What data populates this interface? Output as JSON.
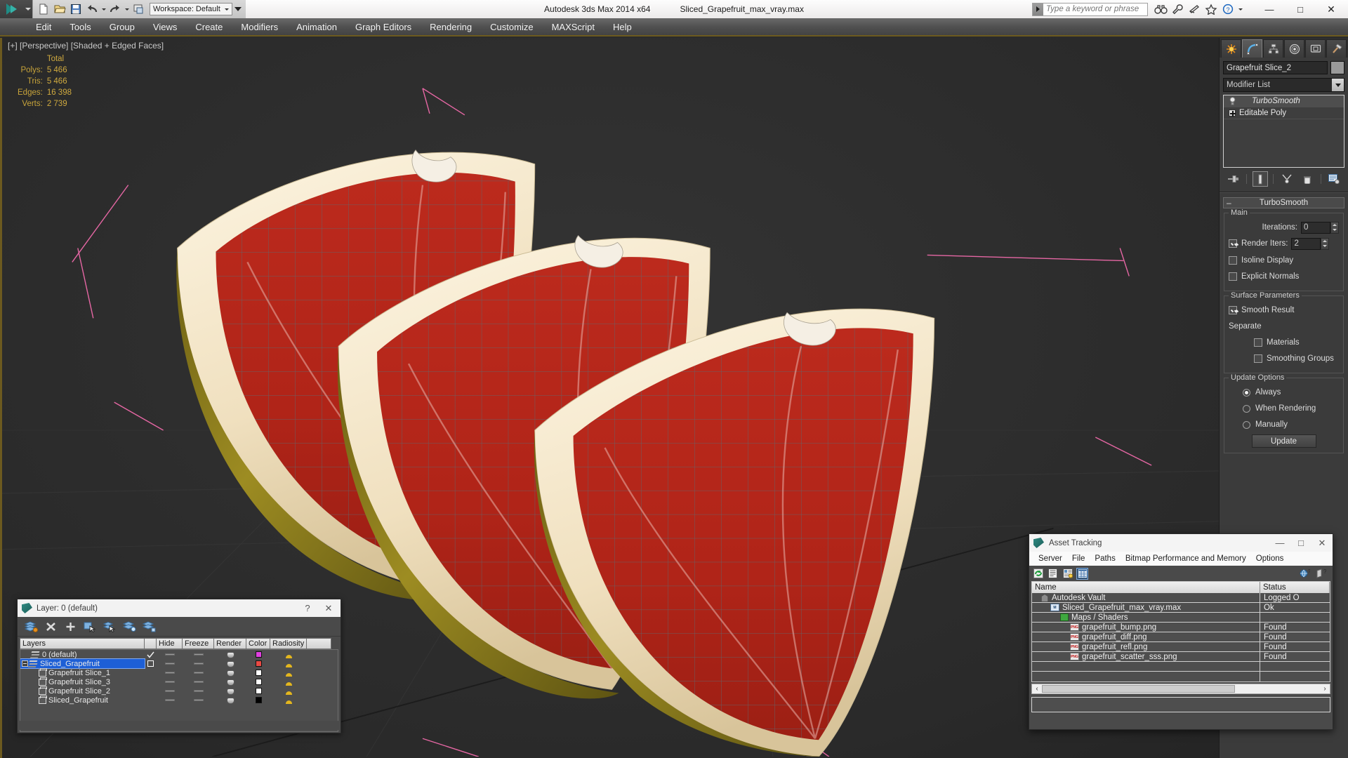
{
  "titlebar": {
    "app_title": "Autodesk 3ds Max  2014 x64",
    "file_title": "Sliced_Grapefruit_max_vray.max",
    "workspace_label": "Workspace: Default",
    "quick_access": [
      {
        "name": "new-file-icon",
        "label": "New"
      },
      {
        "name": "open-file-icon",
        "label": "Open"
      },
      {
        "name": "save-file-icon",
        "label": "Save"
      },
      {
        "name": "undo-icon",
        "label": "Undo"
      },
      {
        "name": "redo-icon",
        "label": "Redo"
      },
      {
        "name": "project-folder-icon",
        "label": "Set Project Folder"
      }
    ],
    "search_placeholder": "Type a keyword or phrase",
    "right_icons": [
      "binoculars-icon",
      "wrench-icon",
      "satellite-icon",
      "star-icon",
      "help-icon"
    ],
    "window_buttons": {
      "minimize": "—",
      "maximize": "□",
      "close": "✕"
    }
  },
  "menubar": {
    "items": [
      "Edit",
      "Tools",
      "Group",
      "Views",
      "Create",
      "Modifiers",
      "Animation",
      "Graph Editors",
      "Rendering",
      "Customize",
      "MAXScript",
      "Help"
    ]
  },
  "viewport": {
    "label": "[+] [Perspective] [Shaded + Edged Faces]",
    "stats": {
      "header": "Total",
      "rows": [
        {
          "label": "Polys:",
          "value": "5 466"
        },
        {
          "label": "Tris:",
          "value": "5 466"
        },
        {
          "label": "Edges:",
          "value": "16 398"
        },
        {
          "label": "Verts:",
          "value": "2 739"
        }
      ]
    },
    "colors": {
      "background": "#2e2e2e",
      "flesh_red": "#b5261b",
      "pith_cream": "#f2e3c8",
      "peel_olive": "#8a7a1c",
      "selection_bracket": "#e667a4",
      "wireframe": "#6e7b80"
    }
  },
  "command_panel": {
    "tabs": [
      {
        "name": "create-tab",
        "icon": "star-burst-icon",
        "active": false
      },
      {
        "name": "modify-tab",
        "icon": "curve-arc-icon",
        "active": true
      },
      {
        "name": "hierarchy-tab",
        "icon": "hierarchy-icon",
        "active": false
      },
      {
        "name": "motion-tab",
        "icon": "motion-wheel-icon",
        "active": false
      },
      {
        "name": "display-tab",
        "icon": "display-monitor-icon",
        "active": false
      },
      {
        "name": "utilities-tab",
        "icon": "hammer-icon",
        "active": false
      }
    ],
    "object_name": "Grapefruit Slice_2",
    "modifier_list_label": "Modifier List",
    "stack": [
      {
        "label": "TurboSmooth",
        "selected": true,
        "icon": "lightbulb-icon"
      },
      {
        "label": "Editable Poly",
        "selected": false,
        "icon": "plus-box-icon"
      }
    ],
    "stack_buttons": [
      "pin-stack-icon",
      "show-end-result-icon",
      "make-unique-icon",
      "remove-modifier-icon",
      "configure-sets-icon"
    ],
    "rollout": {
      "title": "TurboSmooth",
      "collapse_glyph": "–",
      "main": {
        "title": "Main",
        "iterations_label": "Iterations:",
        "iterations_value": "0",
        "render_iters_label": "Render Iters:",
        "render_iters_value": "2",
        "render_iters_checked": true,
        "isoline_display_label": "Isoline Display",
        "isoline_display_checked": false,
        "explicit_normals_label": "Explicit Normals",
        "explicit_normals_checked": false
      },
      "surface_parameters": {
        "title": "Surface Parameters",
        "smooth_result_label": "Smooth Result",
        "smooth_result_checked": true,
        "separate_label": "Separate",
        "materials_label": "Materials",
        "materials_checked": false,
        "smoothing_groups_label": "Smoothing Groups",
        "smoothing_groups_checked": false
      },
      "update_options": {
        "title": "Update Options",
        "options": [
          {
            "label": "Always",
            "selected": true
          },
          {
            "label": "When Rendering",
            "selected": false
          },
          {
            "label": "Manually",
            "selected": false
          }
        ],
        "update_button": "Update"
      }
    }
  },
  "layer_dialog": {
    "title": "Layer: 0 (default)",
    "help_glyph": "?",
    "close_glyph": "✕",
    "toolbar_icons": [
      "create-new-layer-icon",
      "delete-layer-icon",
      "add-layer-icon",
      "select-objects-icon",
      "select-highlight-icon",
      "hide-layer-icon",
      "layer-properties-icon"
    ],
    "columns": [
      "Layers",
      "",
      "Hide",
      "Freeze",
      "Render",
      "Color",
      "Radiosity",
      ""
    ],
    "rows": [
      {
        "name": "0 (default)",
        "indent": 1,
        "icon": "layers-icon",
        "hide_check": true,
        "color": "#e040e0",
        "selected": false,
        "expander": false
      },
      {
        "name": "Sliced_Grapefruit",
        "indent": 0,
        "icon": "layers-icon",
        "hide_check": false,
        "color": "#e84a44",
        "selected": true,
        "expander": true
      },
      {
        "name": "Grapefruit Slice_1",
        "indent": 2,
        "icon": "object-cube-icon",
        "color": "#ffffff",
        "selected": false,
        "expander": false
      },
      {
        "name": "Grapefruit Slice_3",
        "indent": 2,
        "icon": "object-cube-icon",
        "color": "#ffffff",
        "selected": false,
        "expander": false
      },
      {
        "name": "Grapefruit Slice_2",
        "indent": 2,
        "icon": "object-cube-icon",
        "color": "#ffffff",
        "selected": false,
        "expander": false
      },
      {
        "name": "Sliced_Grapefruit",
        "indent": 2,
        "icon": "object-cube-icon",
        "color": "#000000",
        "selected": false,
        "expander": false
      }
    ]
  },
  "asset_tracking": {
    "title": "Asset Tracking",
    "window_buttons": {
      "minimize": "—",
      "maximize": "□",
      "close": "✕"
    },
    "menus": [
      "Server",
      "File",
      "Paths",
      "Bitmap Performance and Memory",
      "Options"
    ],
    "toolbar_icons": [
      "refresh-icon",
      "list-view-icon",
      "detail-view-icon",
      "grid-view-icon"
    ],
    "toolbar_right_icons": [
      "help-globe-icon",
      "help-question-icon"
    ],
    "columns": [
      "Name",
      "Status"
    ],
    "rows": [
      {
        "name": "Autodesk Vault",
        "status": "Logged O",
        "indent": 0,
        "icon": "vault-icon"
      },
      {
        "name": "Sliced_Grapefruit_max_vray.max",
        "status": "Ok",
        "indent": 1,
        "icon": "max-file-icon"
      },
      {
        "name": "Maps / Shaders",
        "status": "",
        "indent": 2,
        "icon": "maps-shaders-icon"
      },
      {
        "name": "grapefruit_bump.png",
        "status": "Found",
        "indent": 3,
        "icon": "png-file-icon"
      },
      {
        "name": "grapefruit_diff.png",
        "status": "Found",
        "indent": 3,
        "icon": "png-file-icon"
      },
      {
        "name": "grapefruit_refl.png",
        "status": "Found",
        "indent": 3,
        "icon": "png-file-icon"
      },
      {
        "name": "grapefruit_scatter_sss.png",
        "status": "Found",
        "indent": 3,
        "icon": "png-file-icon"
      },
      {
        "name": "",
        "status": "",
        "indent": 0,
        "icon": ""
      },
      {
        "name": "",
        "status": "",
        "indent": 0,
        "icon": ""
      }
    ],
    "scroll_left_glyph": "‹",
    "scroll_right_glyph": "›"
  }
}
